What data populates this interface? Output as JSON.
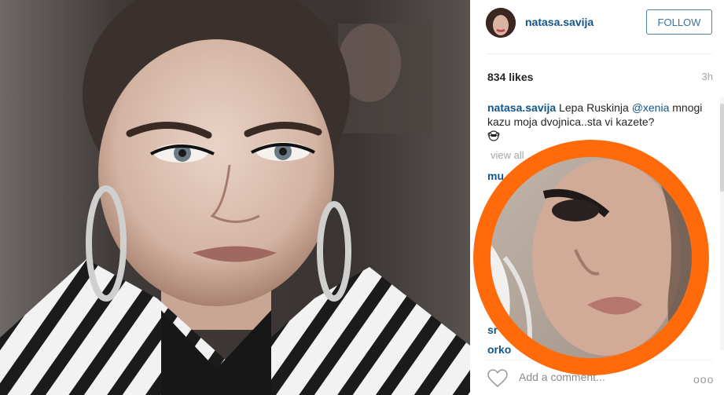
{
  "post": {
    "username": "natasa.savija",
    "follow_label": "FOLLOW",
    "likes": "834 likes",
    "time_ago": "3h"
  },
  "caption": {
    "username": "natasa.savija",
    "text_before_mention": " Lepa Ruskinja ",
    "mention": "@xenia",
    "text_after": " mnogi kazu moja dvojnica..sta vi kazete?"
  },
  "comments": {
    "view_all": "view all",
    "items": [
      "mu",
      "sr",
      "orko"
    ]
  },
  "footer": {
    "add_comment_placeholder": "Add a comment...",
    "more_label": "ooo"
  },
  "colors": {
    "accent_ring": "#ff6a0b",
    "link_blue": "#125688",
    "follow_border": "#4e7ea8"
  }
}
